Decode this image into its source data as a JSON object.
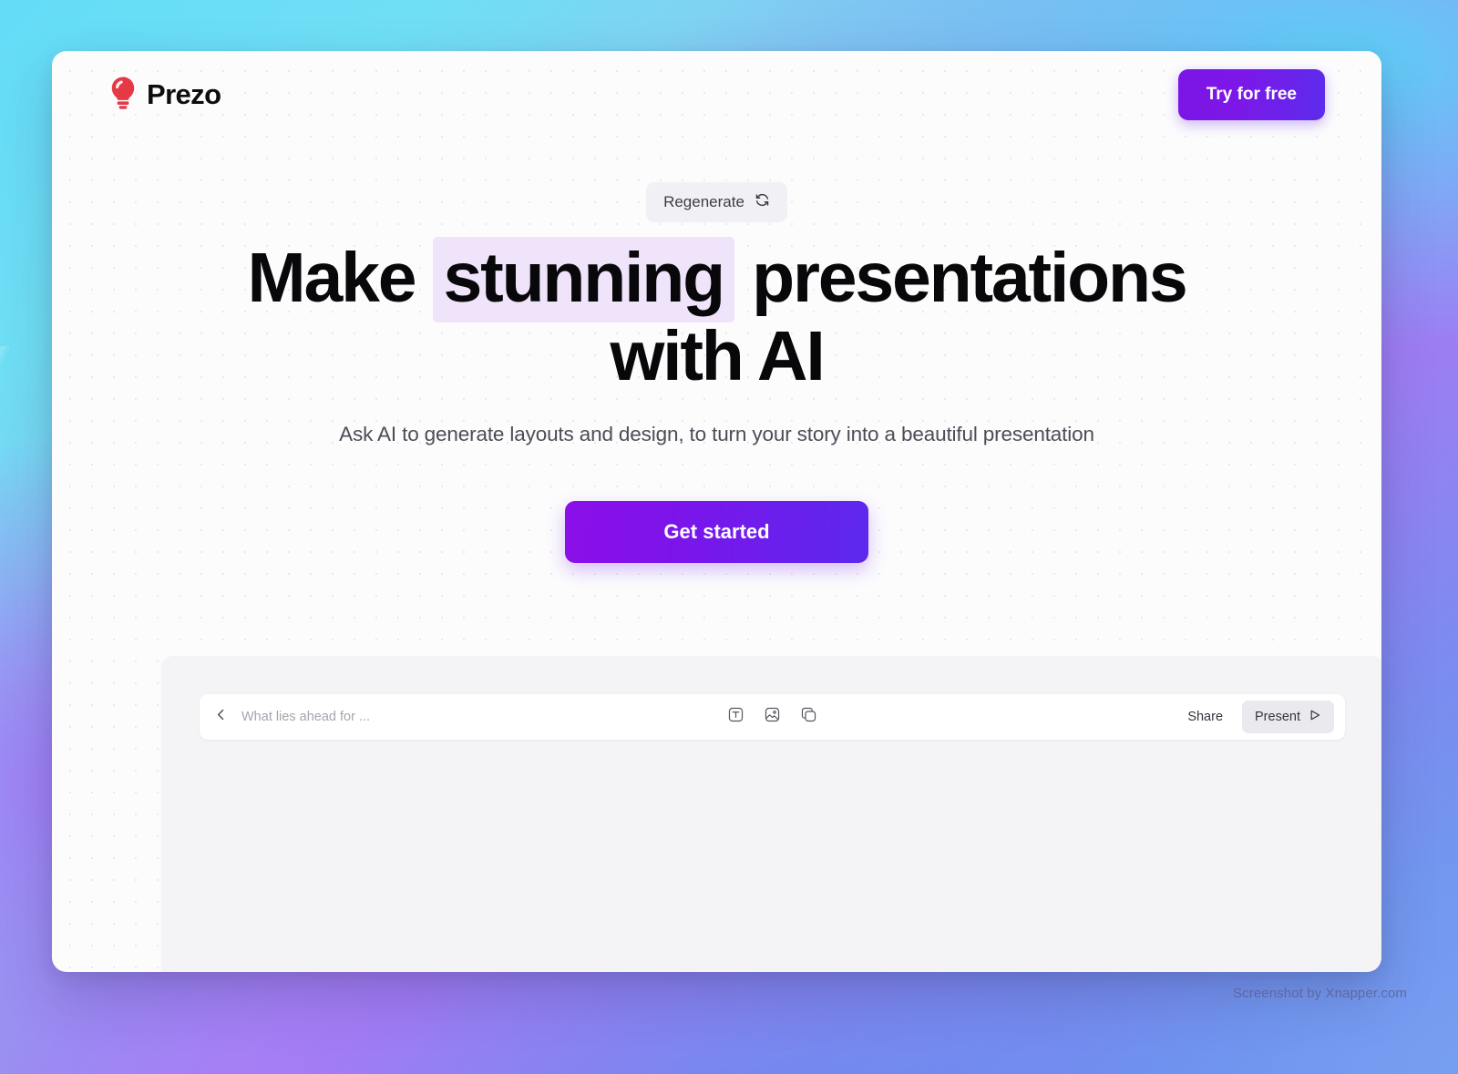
{
  "brand": {
    "name": "Prezo",
    "logo_icon": "lightbulb-icon",
    "logo_color": "#e63946"
  },
  "header": {
    "try_free_label": "Try for free"
  },
  "hero": {
    "regenerate_label": "Regenerate",
    "regenerate_icon": "refresh-cycle-icon",
    "title_part1": "Make ",
    "title_highlight": "stunning",
    "title_part2": " presentations with AI",
    "subtitle": "Ask AI to generate layouts and design, to turn your story into a beautiful presentation",
    "cta_label": "Get started",
    "highlight_color": "#f0e4fb",
    "cta_gradient_from": "#8b0fe8",
    "cta_gradient_to": "#5c28ee"
  },
  "editor": {
    "back_icon": "chevron-left-icon",
    "deck_title": "What lies ahead for ...",
    "tools": [
      {
        "name": "text-tool-icon",
        "label": "Text"
      },
      {
        "name": "image-tool-icon",
        "label": "Image"
      },
      {
        "name": "shape-tool-icon",
        "label": "Shape"
      }
    ],
    "share_label": "Share",
    "present_label": "Present",
    "present_icon": "play-triangle-icon"
  },
  "watermark": {
    "text": "Screenshot by Xnapper.com"
  }
}
